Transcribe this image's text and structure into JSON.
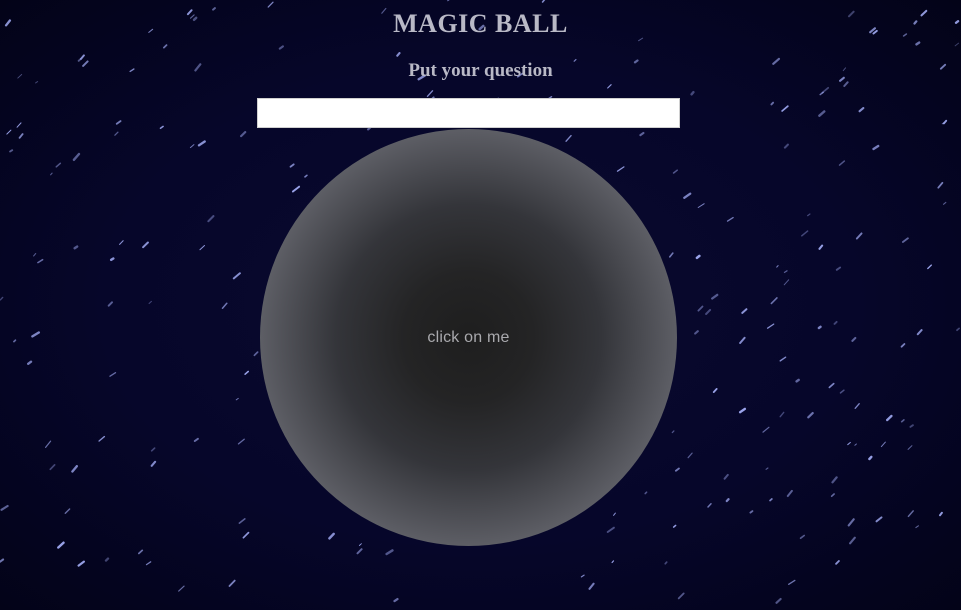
{
  "header": {
    "title": "MAGIC BALL",
    "subtitle": "Put your question"
  },
  "question": {
    "value": "",
    "placeholder": ""
  },
  "ball": {
    "label": "click on me"
  },
  "colors": {
    "background": "#06062a",
    "star": "#aab4ff",
    "heading_text": "#b9b9c6",
    "ball_center": "#1e1e1e",
    "ball_edge": "#8a8b90"
  }
}
